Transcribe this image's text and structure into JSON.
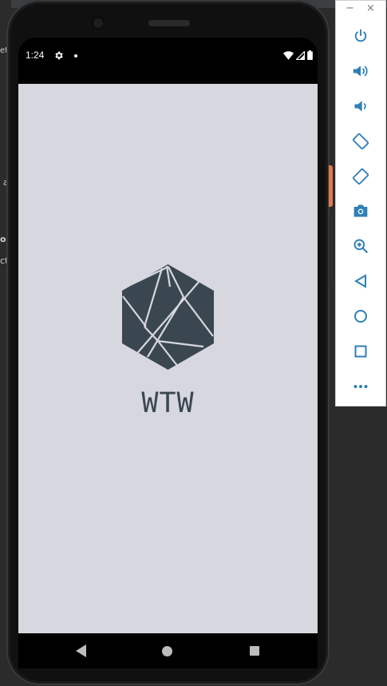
{
  "ide": {
    "left_fragments": [
      "et",
      "a",
      "o",
      "ct"
    ]
  },
  "status_bar": {
    "time": "1:24",
    "icons": [
      "gear-icon",
      "notification-dot-icon",
      "wifi-icon",
      "signal-icon",
      "battery-icon"
    ]
  },
  "app": {
    "title": "WTW",
    "logo": "hexagon-logo-icon",
    "background_color": "#d6d7df",
    "logo_color": "#3b4750"
  },
  "nav_bar": {
    "buttons": [
      "back-icon",
      "home-icon",
      "recents-icon"
    ]
  },
  "emulator_toolbar": {
    "window_buttons": [
      "−",
      "×"
    ],
    "tools": [
      "power-icon",
      "volume-up-icon",
      "volume-down-icon",
      "rotate-left-icon",
      "rotate-right-icon",
      "screenshot-icon",
      "zoom-icon",
      "back-icon",
      "home-icon",
      "overview-icon",
      "more-icon"
    ],
    "accent_color": "#2f7fb5"
  }
}
